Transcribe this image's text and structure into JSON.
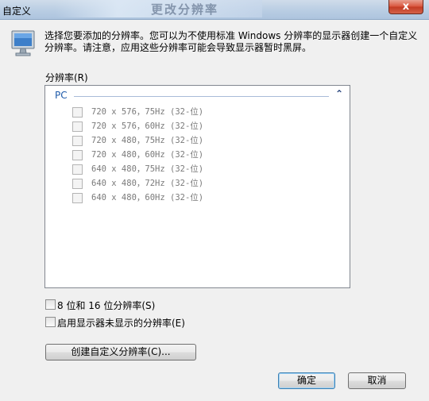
{
  "window": {
    "title": "自定义",
    "background_title": "更改分辨率",
    "close_label": "x"
  },
  "header": {
    "description": "选择您要添加的分辨率。您可以为不使用标准 Windows 分辨率的显示器创建一个自定义分辨率。请注意，应用这些分辨率可能会导致显示器暂时黑屏。"
  },
  "resolution_list": {
    "label": "分辨率(R)",
    "group": {
      "title": "PC",
      "chevron": "⌃"
    },
    "items": [
      {
        "label": "720 x 576，75Hz (32-位)",
        "checked": false
      },
      {
        "label": "720 x 576，60Hz (32-位)",
        "checked": false
      },
      {
        "label": "720 x 480，75Hz (32-位)",
        "checked": false
      },
      {
        "label": "720 x 480，60Hz (32-位)",
        "checked": false
      },
      {
        "label": "640 x 480，75Hz (32-位)",
        "checked": false
      },
      {
        "label": "640 x 480，72Hz (32-位)",
        "checked": false
      },
      {
        "label": "640 x 480，60Hz (32-位)",
        "checked": false
      }
    ]
  },
  "options": {
    "low_color_label": "8 位和 16 位分辨率(S)",
    "hidden_modes_label": "启用显示器未显示的分辨率(E)"
  },
  "buttons": {
    "create_custom": "创建自定义分辨率(C)...",
    "ok": "确定",
    "cancel": "取消"
  }
}
